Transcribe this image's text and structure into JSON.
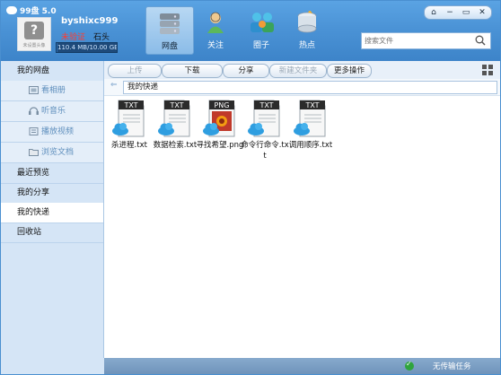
{
  "app": {
    "title": "99盘 5.0"
  },
  "user": {
    "avatar_caption": "未设置头像",
    "name": "byshixc999",
    "status": "未验证",
    "nickname": "石头",
    "quota": "110.4 MB/10.00 GB",
    "quota_fraction": 0.011
  },
  "nav": [
    {
      "label": "网盘",
      "icon": "drive-icon",
      "active": true
    },
    {
      "label": "关注",
      "icon": "follow-icon",
      "active": false
    },
    {
      "label": "圈子",
      "icon": "circle-icon",
      "active": false
    },
    {
      "label": "热点",
      "icon": "hotspot-icon",
      "active": false
    }
  ],
  "window_controls": [
    "⌂",
    "−",
    "▭",
    "✕"
  ],
  "search": {
    "placeholder": "搜索文件"
  },
  "sidebar": {
    "items": [
      {
        "label": "我的网盘",
        "type": "main"
      },
      {
        "label": "看相册",
        "type": "sub",
        "icon": "photo-icon"
      },
      {
        "label": "听音乐",
        "type": "sub",
        "icon": "headphones-icon"
      },
      {
        "label": "播放视频",
        "type": "sub",
        "icon": "video-icon"
      },
      {
        "label": "浏览文档",
        "type": "sub",
        "icon": "folder-icon"
      },
      {
        "label": "最近预览",
        "type": "main"
      },
      {
        "label": "我的分享",
        "type": "main"
      },
      {
        "label": "我的快递",
        "type": "main",
        "active": true
      },
      {
        "label": "回收站",
        "type": "main"
      }
    ]
  },
  "toolbar": {
    "upload": "上传",
    "download": "下载",
    "share": "分享",
    "new_folder": "新建文件夹",
    "more": "更多操作"
  },
  "path": {
    "current": "我的快递"
  },
  "files": [
    {
      "name": "杀进程.txt",
      "type": "TXT"
    },
    {
      "name": "数据检索.txt",
      "type": "TXT"
    },
    {
      "name": "寻找希望.png",
      "type": "PNG"
    },
    {
      "name": "命令行命令.txt",
      "type": "TXT"
    },
    {
      "name": "调用顺序.txt",
      "type": "TXT"
    }
  ],
  "status": {
    "text": "无传输任务"
  },
  "colors": {
    "header": "#4b93d6",
    "accent": "#3d84c9",
    "warning": "#ff3b2f",
    "ok": "#2fa43d"
  }
}
